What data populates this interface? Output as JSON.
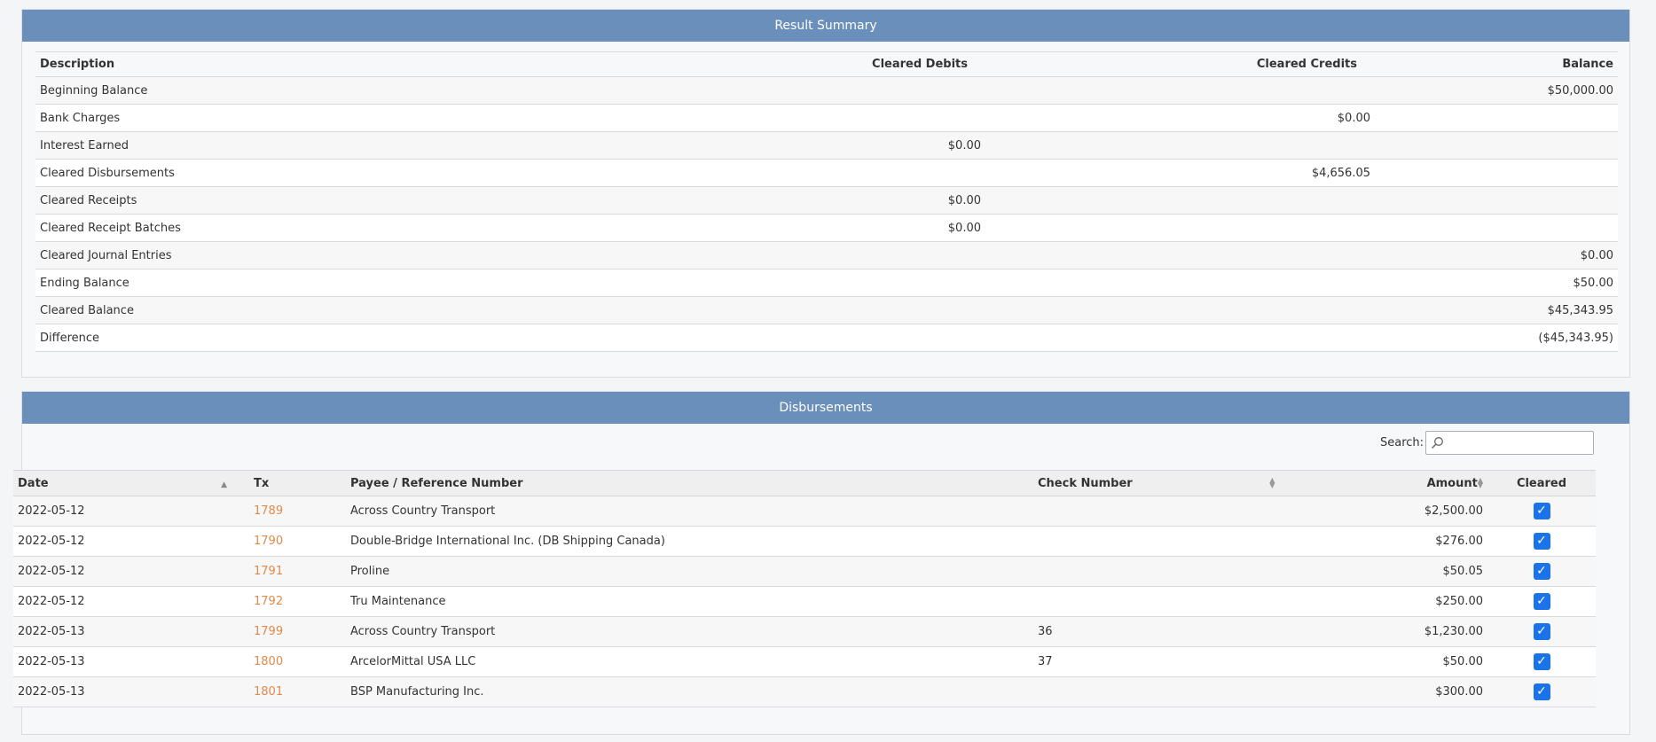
{
  "summary": {
    "title": "Result Summary",
    "headers": {
      "description": "Description",
      "debits": "Cleared Debits",
      "credits": "Cleared Credits",
      "balance": "Balance"
    },
    "rows": [
      {
        "description": "Beginning Balance",
        "debits": "",
        "credits": "",
        "balance": "$50,000.00"
      },
      {
        "description": "Bank Charges",
        "debits": "",
        "credits": "$0.00",
        "balance": ""
      },
      {
        "description": "Interest Earned",
        "debits": "$0.00",
        "credits": "",
        "balance": ""
      },
      {
        "description": "Cleared Disbursements",
        "debits": "",
        "credits": "$4,656.05",
        "balance": ""
      },
      {
        "description": "Cleared Receipts",
        "debits": "$0.00",
        "credits": "",
        "balance": ""
      },
      {
        "description": "Cleared Receipt Batches",
        "debits": "$0.00",
        "credits": "",
        "balance": ""
      },
      {
        "description": "Cleared Journal Entries",
        "debits": "",
        "credits": "",
        "balance": "$0.00"
      },
      {
        "description": "Ending Balance",
        "debits": "",
        "credits": "",
        "balance": "$50.00"
      },
      {
        "description": "Cleared Balance",
        "debits": "",
        "credits": "",
        "balance": "$45,343.95"
      },
      {
        "description": "Difference",
        "debits": "",
        "credits": "",
        "balance": "($45,343.95)"
      }
    ]
  },
  "disbursements": {
    "title": "Disbursements",
    "search": {
      "label": "Search:",
      "value": ""
    },
    "headers": {
      "date": "Date",
      "tx": "Tx",
      "payee": "Payee / Reference Number",
      "check": "Check Number",
      "amount": "Amount",
      "cleared": "Cleared"
    },
    "rows": [
      {
        "date": "2022-05-12",
        "tx": "1789",
        "payee": "Across Country Transport",
        "check": "",
        "amount": "$2,500.00",
        "cleared": true
      },
      {
        "date": "2022-05-12",
        "tx": "1790",
        "payee": "Double-Bridge International Inc. (DB Shipping Canada)",
        "check": "",
        "amount": "$276.00",
        "cleared": true
      },
      {
        "date": "2022-05-12",
        "tx": "1791",
        "payee": "Proline",
        "check": "",
        "amount": "$50.05",
        "cleared": true
      },
      {
        "date": "2022-05-12",
        "tx": "1792",
        "payee": "Tru Maintenance",
        "check": "",
        "amount": "$250.00",
        "cleared": true
      },
      {
        "date": "2022-05-13",
        "tx": "1799",
        "payee": "Across Country Transport",
        "check": "36",
        "amount": "$1,230.00",
        "cleared": true
      },
      {
        "date": "2022-05-13",
        "tx": "1800",
        "payee": "ArcelorMittal USA LLC",
        "check": "37",
        "amount": "$50.00",
        "cleared": true
      },
      {
        "date": "2022-05-13",
        "tx": "1801",
        "payee": "BSP Manufacturing Inc.",
        "check": "",
        "amount": "$300.00",
        "cleared": true
      }
    ]
  },
  "colors": {
    "header_bar": "#6a8fbb",
    "tx_link": "#e08a4a",
    "checkbox": "#1a73e8"
  },
  "icons": {
    "search": "search-icon",
    "sort": "sort-icon",
    "check": "checkbox-checked-icon"
  }
}
